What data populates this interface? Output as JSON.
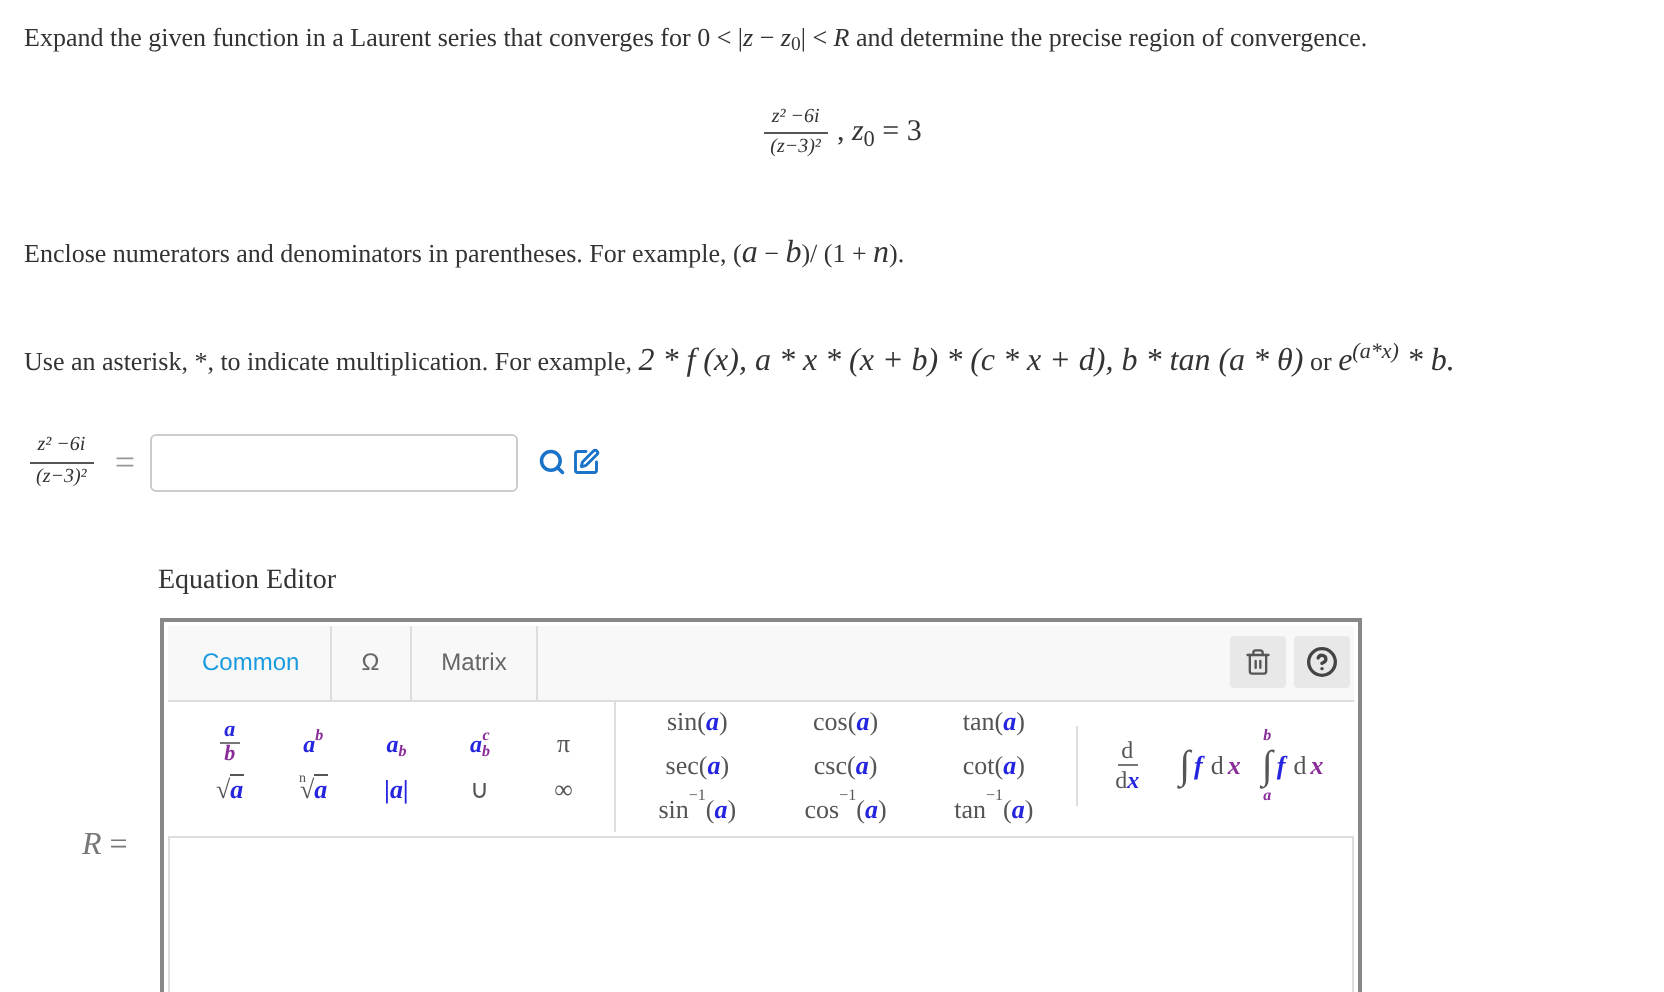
{
  "prompt": "Expand the given function in a Laurent series that converges for 0 < |*z* − *z*$_{0}$| < *R* and determine the precise region of convergence.",
  "function": {
    "numerator": "z² −6i",
    "denominator": "(z−3)²",
    "tail": ", *z*$_{0}$ = 3"
  },
  "hint_1": "Enclose numerators and denominators in parentheses. For example, (*a* − *b*)/ (1 + *n*).",
  "hint_2": {
    "lead": "Use an asterisk, *, to indicate multiplication. For example, ",
    "examples": "2 * f (x), a * x * (x + b) * (c * x + d), b * tan (a * θ)",
    "joiner": " or ",
    "base": "e",
    "power": "(a*x)",
    "end": " * b."
  },
  "answer": {
    "numerator": "z² −6i",
    "denominator": "(z−3)²",
    "equals": "="
  },
  "editor": {
    "title": "Equation Editor",
    "tabs": [
      {
        "label": "Common",
        "selected": true
      },
      {
        "label": "Ω",
        "selected": false
      },
      {
        "label": "Matrix",
        "selected": false
      }
    ],
    "groups": [
      {
        "items": [
          {
            "kind": "frac",
            "top": "a",
            "bottom": "b"
          },
          {
            "kind": "script",
            "base": "a",
            "sup": "b"
          },
          {
            "kind": "script",
            "base": "a",
            "sub": "b"
          },
          {
            "kind": "script",
            "base": "a",
            "sup": "c",
            "sub": "b"
          },
          {
            "kind": "symbol",
            "text": "π"
          },
          {
            "kind": "root",
            "sign": "√",
            "radicand": "a"
          },
          {
            "kind": "root",
            "index": "n",
            "sign": "√",
            "radicand": "a"
          },
          {
            "kind": "abs",
            "text": "|a|"
          },
          {
            "kind": "symbol",
            "text": "∪"
          },
          {
            "kind": "symbol",
            "text": "∞"
          }
        ]
      },
      {
        "items": [
          {
            "kind": "func",
            "name": "sin",
            "open": "(",
            "arg": "a",
            "close": ")"
          },
          {
            "kind": "func",
            "name": "cos",
            "open": "(",
            "arg": "a",
            "close": ")"
          },
          {
            "kind": "func",
            "name": "tan",
            "open": "(",
            "arg": "a",
            "close": ")"
          },
          {
            "kind": "func",
            "name": "sec",
            "open": "(",
            "arg": "a",
            "close": ")"
          },
          {
            "kind": "func",
            "name": "csc",
            "open": "(",
            "arg": "a",
            "close": ")"
          },
          {
            "kind": "func",
            "name": "cot",
            "open": "(",
            "arg": "a",
            "close": ")"
          },
          {
            "kind": "func",
            "name": "sin",
            "sup": "−1",
            "open": "(",
            "arg": "a",
            "close": ")"
          },
          {
            "kind": "func",
            "name": "cos",
            "sup": "−1",
            "open": "(",
            "arg": "a",
            "close": ")"
          },
          {
            "kind": "func",
            "name": "tan",
            "sup": "−1",
            "open": "(",
            "arg": "a",
            "close": ")"
          }
        ]
      },
      {
        "items": [
          {
            "kind": "derivative",
            "top": "d",
            "bottom": "d",
            "variable": "x"
          },
          {
            "kind": "integral",
            "sign": "∫",
            "integrand": "f",
            "differential": "d",
            "variable": "x"
          },
          {
            "kind": "integral",
            "sign": "∫",
            "upper": "b",
            "lower": "a",
            "integrand": "f",
            "differential": "d",
            "variable": "x"
          }
        ]
      }
    ],
    "result_label": "*R* ="
  }
}
